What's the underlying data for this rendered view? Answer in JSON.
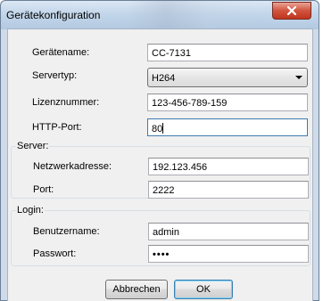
{
  "window": {
    "title": "Gerätekonfiguration"
  },
  "fields": {
    "geraetename": {
      "label": "Gerätename:",
      "value": "CC-7131"
    },
    "servertyp": {
      "label": "Servertyp:",
      "value": "H264"
    },
    "lizenznummer": {
      "label": "Lizenznummer:",
      "value": "123-456-789-159"
    },
    "http_port": {
      "label": "HTTP-Port:",
      "value": "80"
    }
  },
  "server_group": {
    "title": "Server:",
    "netzwerkadresse": {
      "label": "Netzwerkadresse:",
      "value": "192.123.456"
    },
    "port": {
      "label": "Port:",
      "value": "2222"
    }
  },
  "login_group": {
    "title": "Login:",
    "benutzername": {
      "label": "Benutzername:",
      "value": "admin"
    },
    "passwort": {
      "label": "Passwort:",
      "value": "••••"
    }
  },
  "buttons": {
    "cancel": "Abbrechen",
    "ok": "OK"
  },
  "colors": {
    "close_button": "#c7402b",
    "focus_border": "#3d7bad",
    "default_button_glow": "#7dd0f5"
  }
}
